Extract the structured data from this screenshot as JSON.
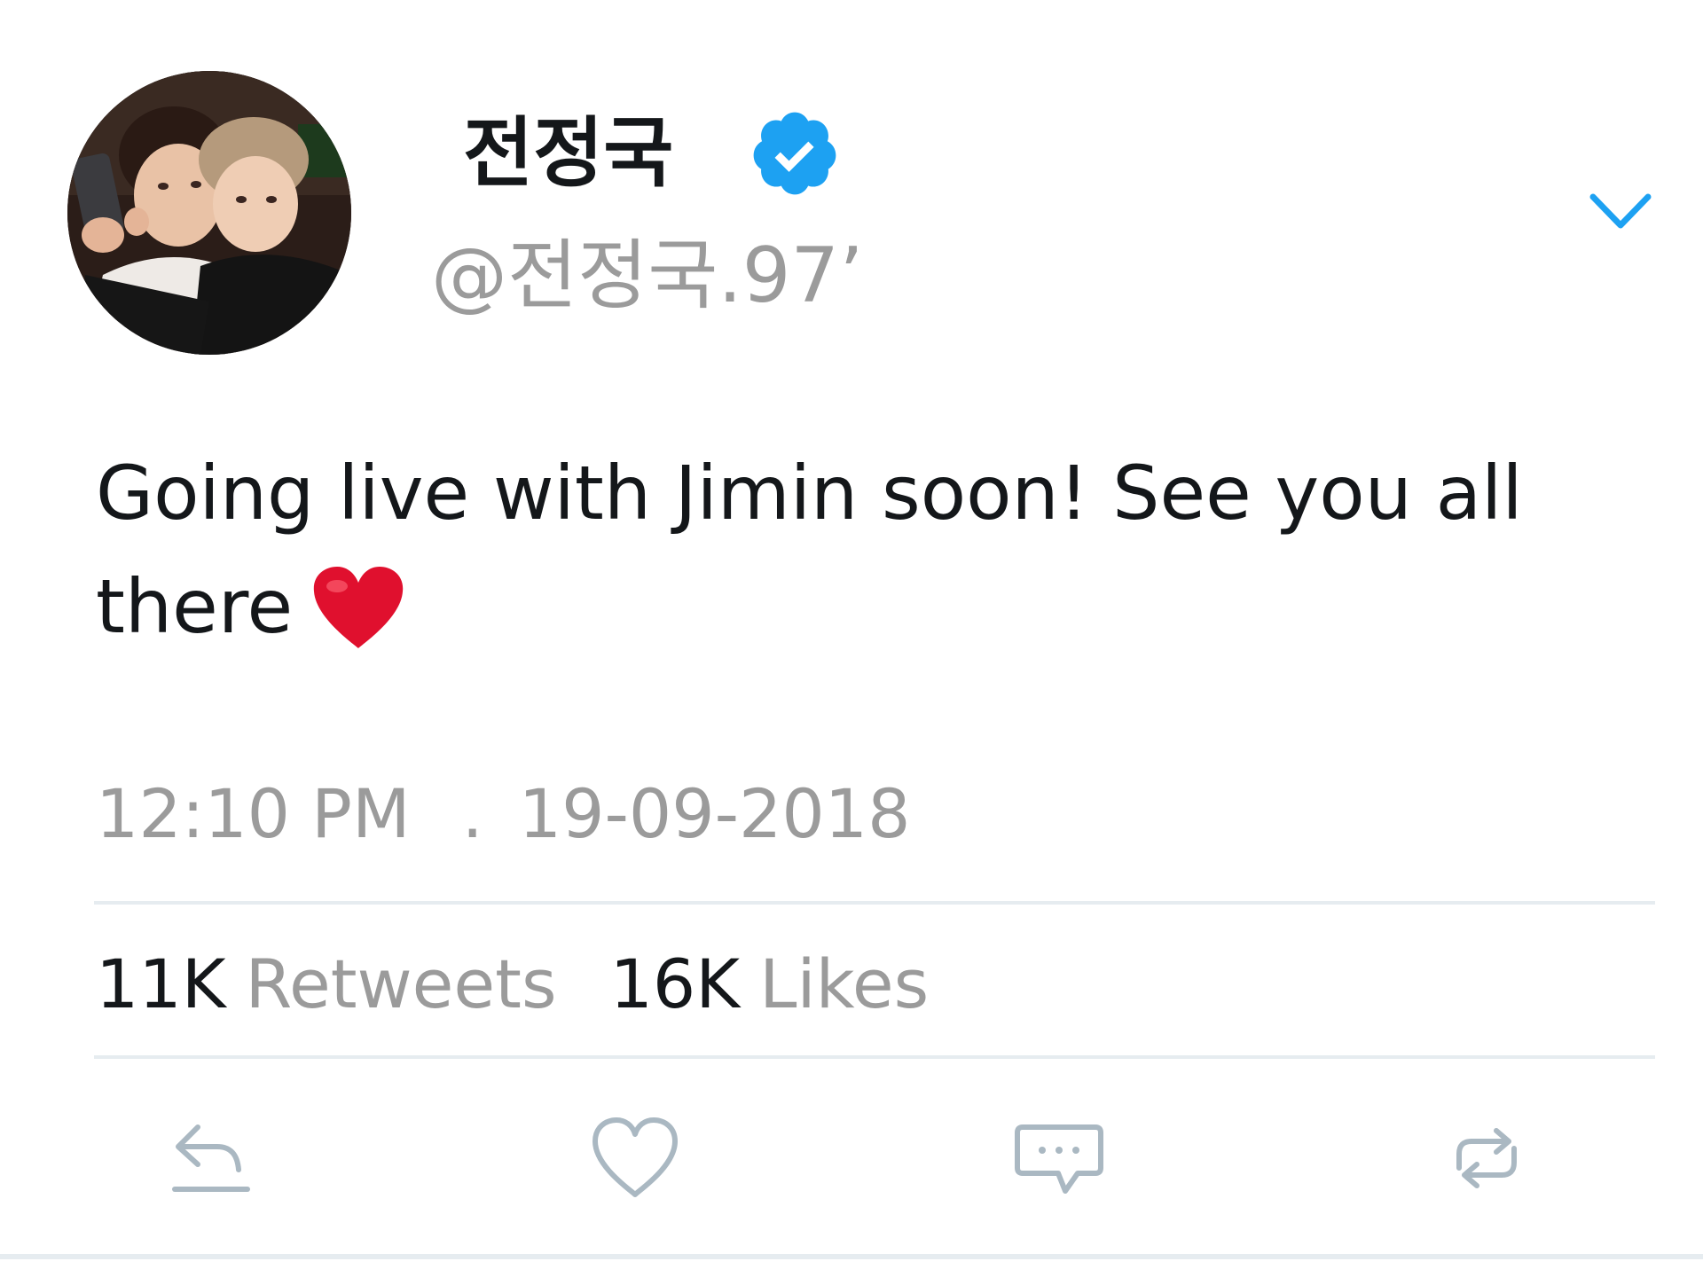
{
  "profile": {
    "display_name": "전정국",
    "handle": "@전정국.97’",
    "verified": true,
    "avatar_icon": "profile-photo"
  },
  "tweet": {
    "text": "Going live with Jimin soon! See you all there",
    "emoji": "heart-emoji",
    "time": "12:10 PM",
    "separator": ".",
    "date": "19-09-2018"
  },
  "stats": {
    "retweets_count": "11K",
    "retweets_label": "Retweets",
    "likes_count": "16K",
    "likes_label": "Likes"
  },
  "actions": [
    {
      "name": "reply",
      "icon": "reply-icon"
    },
    {
      "name": "like",
      "icon": "heart-icon"
    },
    {
      "name": "message",
      "icon": "message-icon"
    },
    {
      "name": "retweet",
      "icon": "retweet-icon"
    }
  ],
  "colors": {
    "accent": "#1da1f2",
    "text": "#14171a",
    "secondary_text": "#9b9b9b",
    "divider": "#e6ecf0",
    "icon": "#aab8c2",
    "heart": "#e0102e"
  }
}
